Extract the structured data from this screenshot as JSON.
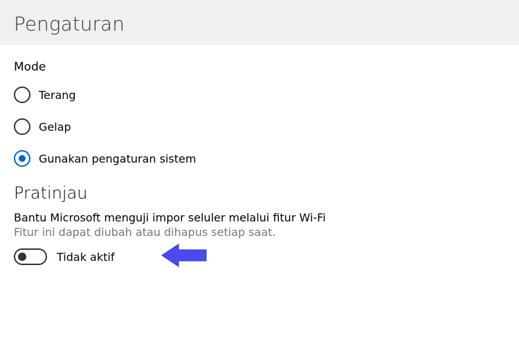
{
  "header": {
    "title": "Pengaturan"
  },
  "mode": {
    "label": "Mode",
    "options": [
      {
        "label": "Terang",
        "selected": false
      },
      {
        "label": "Gelap",
        "selected": false
      },
      {
        "label": "Gunakan pengaturan sistem",
        "selected": true
      }
    ]
  },
  "preview": {
    "heading": "Pratinjau",
    "desc": "Bantu Microsoft menguji impor seluler melalui fitur Wi-Fi",
    "subdesc": "Fitur ini dapat diubah atau dihapus setiap saat.",
    "toggle_label": "Tidak aktif",
    "toggle_on": false
  }
}
